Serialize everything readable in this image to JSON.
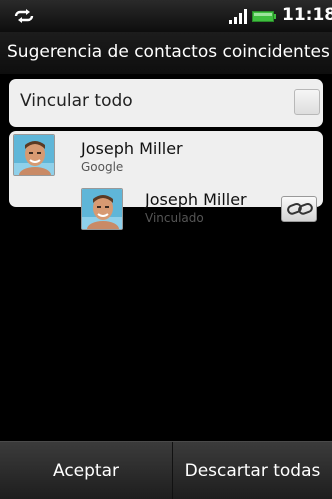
{
  "statusbar": {
    "time": "11:18",
    "icons": [
      "sync-icon",
      "signal-icon",
      "battery-icon"
    ]
  },
  "header": {
    "title": "Sugerencia de contactos coincidentes"
  },
  "link_all": {
    "label": "Vincular todo",
    "checked": false
  },
  "contacts": [
    {
      "name": "Joseph Miller",
      "account": "Google"
    },
    {
      "name": "Joseph Miller",
      "account": "Vinculado"
    }
  ],
  "footer": {
    "accept_label": "Aceptar",
    "dismiss_label": "Descartar todas"
  },
  "colors": {
    "card_background": "#efefef",
    "screen_background": "#000000",
    "battery": "#3fbf3f"
  }
}
